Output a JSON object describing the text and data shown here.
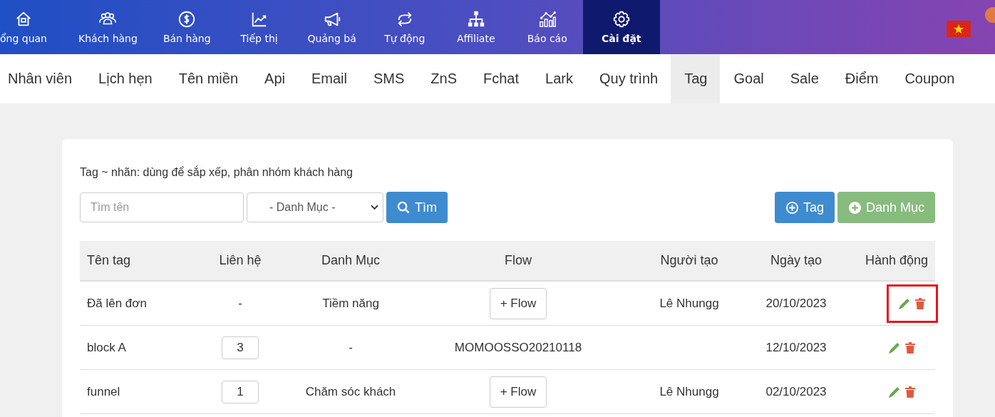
{
  "top_nav": [
    {
      "label": "ổng quan",
      "selected": false
    },
    {
      "label": "Khách hàng",
      "selected": false
    },
    {
      "label": "Bán hàng",
      "selected": false
    },
    {
      "label": "Tiếp thị",
      "selected": false
    },
    {
      "label": "Quảng bá",
      "selected": false
    },
    {
      "label": "Tự động",
      "selected": false
    },
    {
      "label": "Affiliate",
      "selected": false
    },
    {
      "label": "Báo cáo",
      "selected": false
    },
    {
      "label": "Cài đặt",
      "selected": true
    }
  ],
  "sub_nav": [
    {
      "label": "Nhân viên",
      "selected": false
    },
    {
      "label": "Lịch hẹn",
      "selected": false
    },
    {
      "label": "Tên miền",
      "selected": false
    },
    {
      "label": "Api",
      "selected": false
    },
    {
      "label": "Email",
      "selected": false
    },
    {
      "label": "SMS",
      "selected": false
    },
    {
      "label": "ZnS",
      "selected": false
    },
    {
      "label": "Fchat",
      "selected": false
    },
    {
      "label": "Lark",
      "selected": false
    },
    {
      "label": "Quy trình",
      "selected": false
    },
    {
      "label": "Tag",
      "selected": true
    },
    {
      "label": "Goal",
      "selected": false
    },
    {
      "label": "Sale",
      "selected": false
    },
    {
      "label": "Điểm",
      "selected": false
    },
    {
      "label": "Coupon",
      "selected": false
    }
  ],
  "description": "Tag ~ nhãn: dùng để sắp xếp, phân nhóm khách hàng",
  "search": {
    "placeholder": "Tìm tên"
  },
  "category_select": {
    "value": "- Danh Mục -"
  },
  "search_button": "Tìm",
  "add_tag_button": "Tag",
  "add_category_button": "Danh Mục",
  "table": {
    "columns": [
      "Tên tag",
      "Liên hệ",
      "Danh Mục",
      "Flow",
      "Người tạo",
      "Ngày tạo",
      "Hành động"
    ],
    "rows": [
      {
        "name": "Đã lên đơn",
        "contacts": {
          "kind": "text",
          "text": "-"
        },
        "category": "Tiềm năng",
        "flow": {
          "kind": "button",
          "text": "+ Flow"
        },
        "creator": "Lê Nhungg",
        "date": "20/10/2023",
        "highlighted": true
      },
      {
        "name": "block A",
        "contacts": {
          "kind": "box",
          "text": "3"
        },
        "category": "-",
        "flow": {
          "kind": "text",
          "text": "MOMOOSSO20210118"
        },
        "date": "12/10/2023",
        "highlighted": false
      },
      {
        "name": "funnel",
        "contacts": {
          "kind": "box",
          "text": "1"
        },
        "category": "Chăm sóc khách",
        "flow": {
          "kind": "button",
          "text": "+ Flow"
        },
        "creator": "Lê Nhungg",
        "date": "02/10/2023",
        "highlighted": false
      }
    ]
  }
}
